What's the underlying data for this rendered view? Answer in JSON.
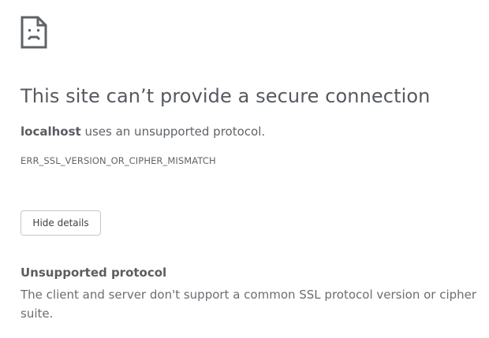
{
  "page": {
    "icon": "sad-page-icon",
    "headline": "This site can’t provide a secure connection",
    "summary": {
      "host": "localhost",
      "message": " uses an unsupported protocol."
    },
    "error_code": "ERR_SSL_VERSION_OR_CIPHER_MISMATCH",
    "details_button_label": "Hide details",
    "details": {
      "title": "Unsupported protocol",
      "text": "The client and server don't support a common SSL protocol version or cipher suite."
    }
  },
  "colors": {
    "text": "#5f6368",
    "icon": "#5f6368",
    "button_border": "#c4c7cb"
  }
}
